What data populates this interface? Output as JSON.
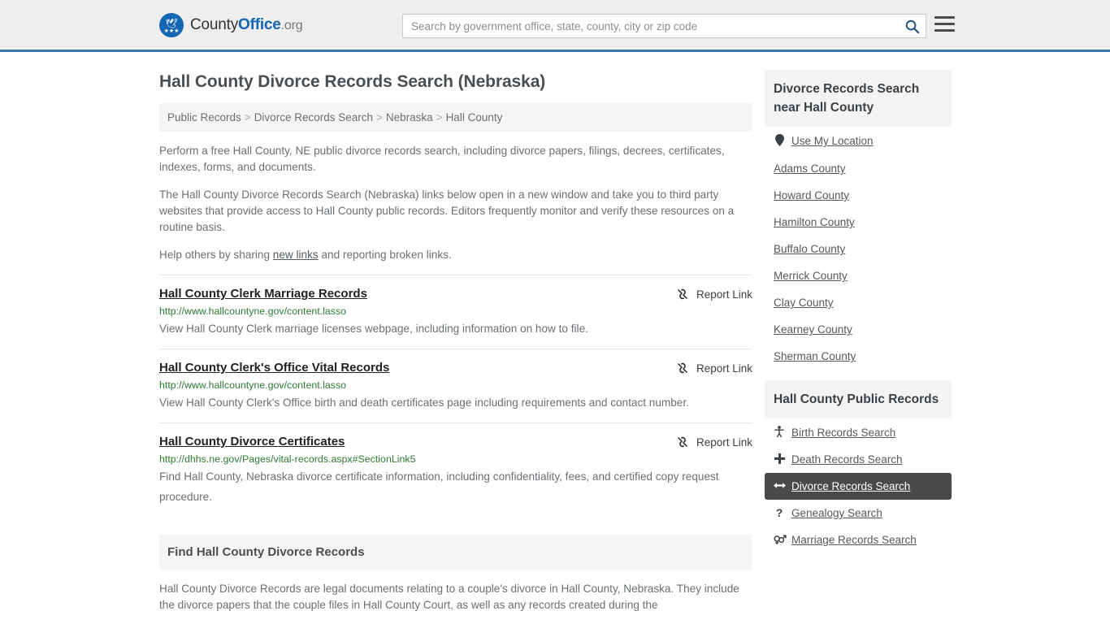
{
  "header": {
    "logo": {
      "text_part1": "County",
      "text_bold": "Office",
      "text_suffix": ".org",
      "bird_glyph": "ᴀ",
      "stars_glyph": "★★★"
    },
    "search": {
      "placeholder": "Search by government office, state, county, city or zip code",
      "value": "",
      "button_icon": "search-icon"
    },
    "menu_icon": "hamburger-menu-icon"
  },
  "page": {
    "title": "Hall County Divorce Records Search (Nebraska)"
  },
  "breadcrumb": {
    "separator": ">",
    "items": [
      {
        "label": "Public Records"
      },
      {
        "label": "Divorce Records Search"
      },
      {
        "label": "Nebraska"
      },
      {
        "label": "Hall County"
      }
    ]
  },
  "intro": {
    "paragraph1": "Perform a free Hall County, NE public divorce records search, including divorce papers, filings, decrees, certificates, indexes, forms, and documents.",
    "paragraph2": "The Hall County Divorce Records Search (Nebraska) links below open in a new window and take you to third party websites that provide access to Hall County public records. Editors frequently monitor and verify these resources on a routine basis.",
    "paragraph3_prefix": "Help others by sharing ",
    "paragraph3_link": "new links",
    "paragraph3_suffix": " and reporting broken links."
  },
  "results": {
    "report_label": "Report Link",
    "report_icon": "broken-link-icon",
    "items": [
      {
        "title": "Hall County Clerk Marriage Records",
        "url": "http://www.hallcountyne.gov/content.lasso",
        "description": "View Hall County Clerk marriage licenses webpage, including information on how to file."
      },
      {
        "title": "Hall County Clerk's Office Vital Records",
        "url": "http://www.hallcountyne.gov/content.lasso",
        "description": "View Hall County Clerk's Office birth and death certificates page including requirements and contact number."
      },
      {
        "title": "Hall County Divorce Certificates",
        "url": "http://dhhs.ne.gov/Pages/vital-records.aspx#SectionLink5",
        "description": "Find Hall County, Nebraska divorce certificate information, including confidentiality, fees, and certified copy request procedure."
      }
    ]
  },
  "find_section": {
    "heading": "Find Hall County Divorce Records",
    "paragraph": "Hall County Divorce Records are legal documents relating to a couple's divorce in Hall County, Nebraska. They include the divorce papers that the couple files in Hall County Court, as well as any records created during the"
  },
  "sidebar": {
    "near_card": {
      "heading": "Divorce Records Search near Hall County",
      "items": [
        {
          "label": "Use My Location",
          "icon": "map-pin-icon",
          "glyph": "▼"
        },
        {
          "label": "Adams County",
          "icon": "",
          "glyph": ""
        },
        {
          "label": "Howard County",
          "icon": "",
          "glyph": ""
        },
        {
          "label": "Hamilton County",
          "icon": "",
          "glyph": ""
        },
        {
          "label": "Buffalo County",
          "icon": "",
          "glyph": ""
        },
        {
          "label": "Merrick County",
          "icon": "",
          "glyph": ""
        },
        {
          "label": "Clay County",
          "icon": "",
          "glyph": ""
        },
        {
          "label": "Kearney County",
          "icon": "",
          "glyph": ""
        },
        {
          "label": "Sherman County",
          "icon": "",
          "glyph": ""
        }
      ]
    },
    "public_records_card": {
      "heading": "Hall County Public Records",
      "items": [
        {
          "label": "Birth Records Search",
          "icon": "baby-icon",
          "glyph": "Ɣ",
          "active": false
        },
        {
          "label": "Death Records Search",
          "icon": "cross-icon",
          "glyph": "✚",
          "active": false
        },
        {
          "label": "Divorce Records Search",
          "icon": "split-arrows-icon",
          "glyph": "↔",
          "active": true
        },
        {
          "label": "Genealogy Search",
          "icon": "question-mark-icon",
          "glyph": "?",
          "active": false
        },
        {
          "label": "Marriage Records Search",
          "icon": "gender-symbols-icon",
          "glyph": "⚥",
          "active": false
        }
      ]
    }
  },
  "colors": {
    "header_bg": "#eeeeee",
    "header_border": "#3a76a8",
    "brand_blue": "#1565b5",
    "panel_bg": "#f5f5f5",
    "active_row_bg": "#4a4a4a",
    "url_green": "#2e7d32",
    "body_text": "#6b7074"
  }
}
